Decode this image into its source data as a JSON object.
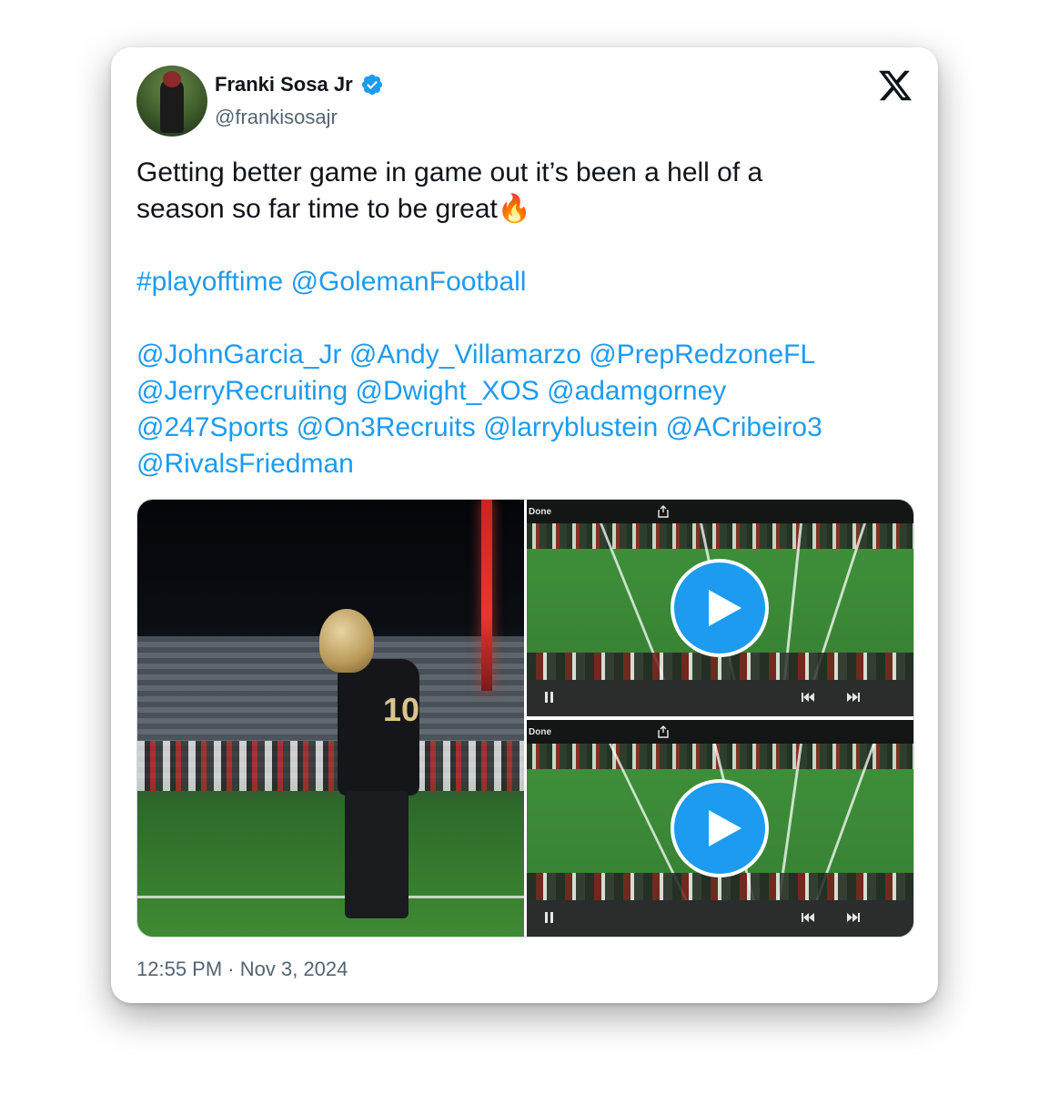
{
  "author": {
    "name": "Franki Sosa Jr",
    "handle": "@frankisosajr",
    "verified": true,
    "verified_color": "#1d9bf0"
  },
  "tweet": {
    "line1": "Getting better game in game out it’s been a hell of a",
    "line2": "season so far time to be great🔥",
    "hashtag": "#playofftime",
    "mention_main": "@GolemanFootball",
    "mentions": [
      [
        "@JohnGarcia_Jr",
        "@Andy_Villamarzo",
        "@PrepRedzoneFL"
      ],
      [
        "@JerryRecruiting",
        "@Dwight_XOS",
        "@adamgorney"
      ],
      [
        "@247Sports",
        "@On3Recruits",
        "@larryblustein",
        "@ACribeiro3"
      ],
      [
        "@RivalsFriedman"
      ]
    ],
    "link_color": "#1d9bf0"
  },
  "media": {
    "photo": {
      "jersey_number": "10"
    },
    "videos": [
      {
        "done_label": "Done"
      },
      {
        "done_label": "Done"
      }
    ]
  },
  "timestamp": {
    "time": "12:55 PM",
    "separator": "·",
    "date": "Nov 3, 2024"
  },
  "icons": {
    "brand": "x-logo-icon",
    "verified": "verified-badge-icon",
    "play": "play-icon",
    "pause": "pause-icon",
    "rewind": "rewind-icon",
    "forward": "fast-forward-icon",
    "share": "share-icon"
  }
}
